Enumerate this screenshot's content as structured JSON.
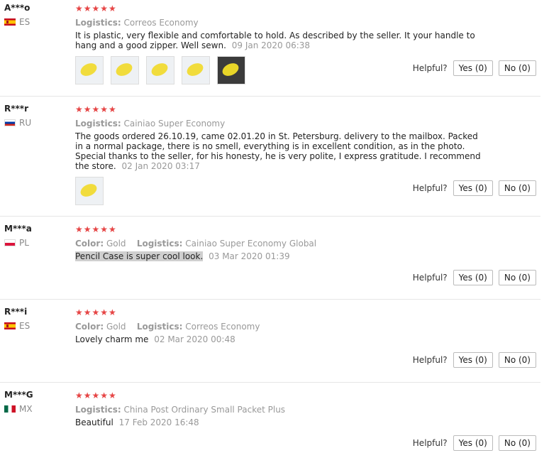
{
  "reviews": [
    {
      "user": "A***o",
      "country": "ES",
      "stars": "★★★★★",
      "logistics_label": "Logistics:",
      "logistics": "Correos Economy",
      "text": "It is plastic, very flexible and comfortable to hold. As described by the seller. It your handle to hang and a good zipper. Well sewn.",
      "date": "09 Jan 2020 06:38",
      "helpful_label": "Helpful?",
      "yes": "Yes (0)",
      "no": "No (0)"
    },
    {
      "user": "R***r",
      "country": "RU",
      "stars": "★★★★★",
      "logistics_label": "Logistics:",
      "logistics": "Cainiao Super Economy",
      "text": "The goods ordered 26.10.19, came 02.01.20 in St. Petersburg. delivery to the mailbox. Packed in a normal package, there is no smell, everything is in excellent condition, as in the photo. Special thanks to the seller, for his honesty, he is very polite, I express gratitude. I recommend the store.",
      "date": "02 Jan 2020 03:17",
      "helpful_label": "Helpful?",
      "yes": "Yes (0)",
      "no": "No (0)"
    },
    {
      "user": "M***a",
      "country": "PL",
      "stars": "★★★★★",
      "color_label": "Color:",
      "color": "Gold",
      "logistics_label": "Logistics:",
      "logistics": "Cainiao Super Economy Global",
      "text": "Pencil Case is super cool look.",
      "date": "03 Mar 2020 01:39",
      "helpful_label": "Helpful?",
      "yes": "Yes (0)",
      "no": "No (0)"
    },
    {
      "user": "R***i",
      "country": "ES",
      "stars": "★★★★★",
      "color_label": "Color:",
      "color": "Gold",
      "logistics_label": "Logistics:",
      "logistics": "Correos Economy",
      "text": "Lovely charm me",
      "date": "02 Mar 2020 00:48",
      "helpful_label": "Helpful?",
      "yes": "Yes (0)",
      "no": "No (0)"
    },
    {
      "user": "M***G",
      "country": "MX",
      "stars": "★★★★★",
      "logistics_label": "Logistics:",
      "logistics": "China Post Ordinary Small Packet Plus",
      "text": "Beautiful",
      "date": "17 Feb 2020 16:48",
      "helpful_label": "Helpful?",
      "yes": "Yes (0)",
      "no": "No (0)"
    }
  ],
  "colors": {
    "star": "#e64545",
    "meta_gray": "#999999",
    "highlight": "#cfcfcf"
  }
}
